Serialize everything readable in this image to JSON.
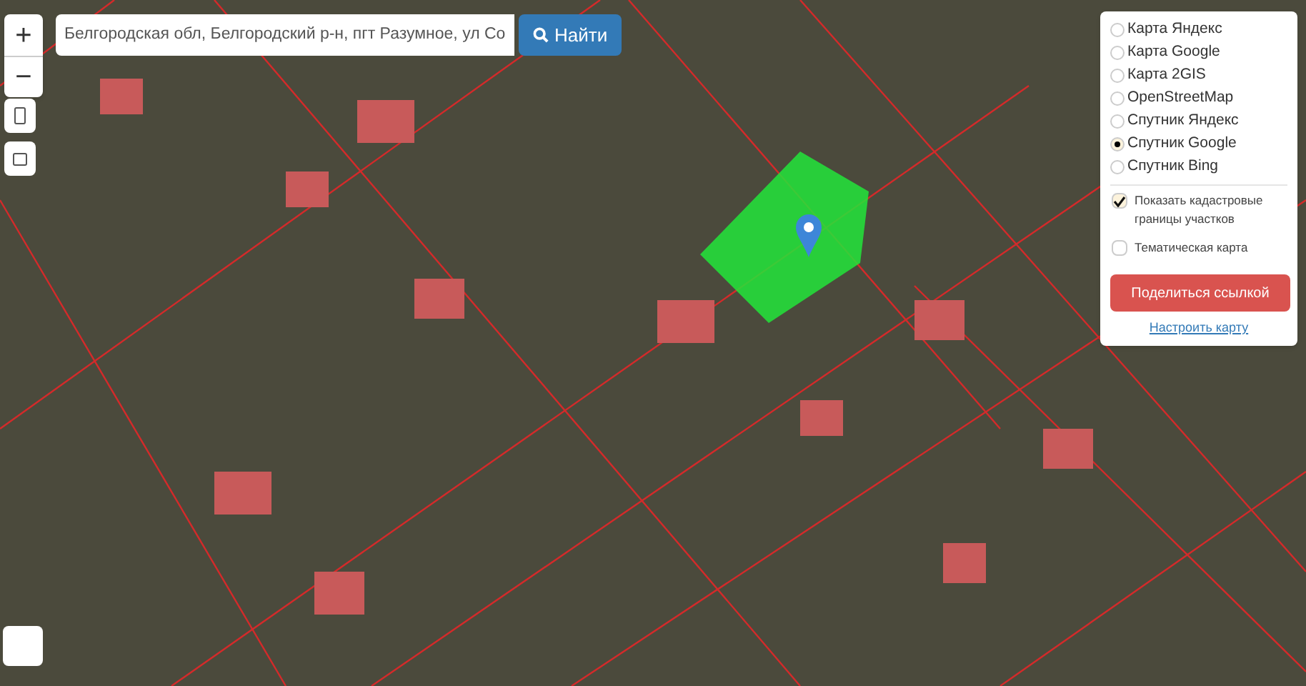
{
  "zoom_controls": [
    {
      "label": "+"
    },
    {
      "label": "−"
    }
  ],
  "search": {
    "value": "Белгородская обл, Белгородский р-н, пгт Разумное, ул Со",
    "button": "Найти"
  },
  "layers": [
    {
      "label": "Карта Яндекс",
      "selected": false
    },
    {
      "label": "Карта Google",
      "selected": false
    },
    {
      "label": "Карта 2GIS",
      "selected": false
    },
    {
      "label": "OpenStreetMap",
      "selected": false
    },
    {
      "label": "Спутник Яндекс",
      "selected": false
    },
    {
      "label": "Спутник Google",
      "selected": true
    },
    {
      "label": "Спутник Bing",
      "selected": false
    }
  ],
  "options": [
    {
      "label": "Показать кадастровые границы участков",
      "checked": true
    },
    {
      "label": "Тематическая карта",
      "checked": false
    }
  ],
  "share_button": "Поделиться ссылкой",
  "settings_link": "Настроить карту"
}
